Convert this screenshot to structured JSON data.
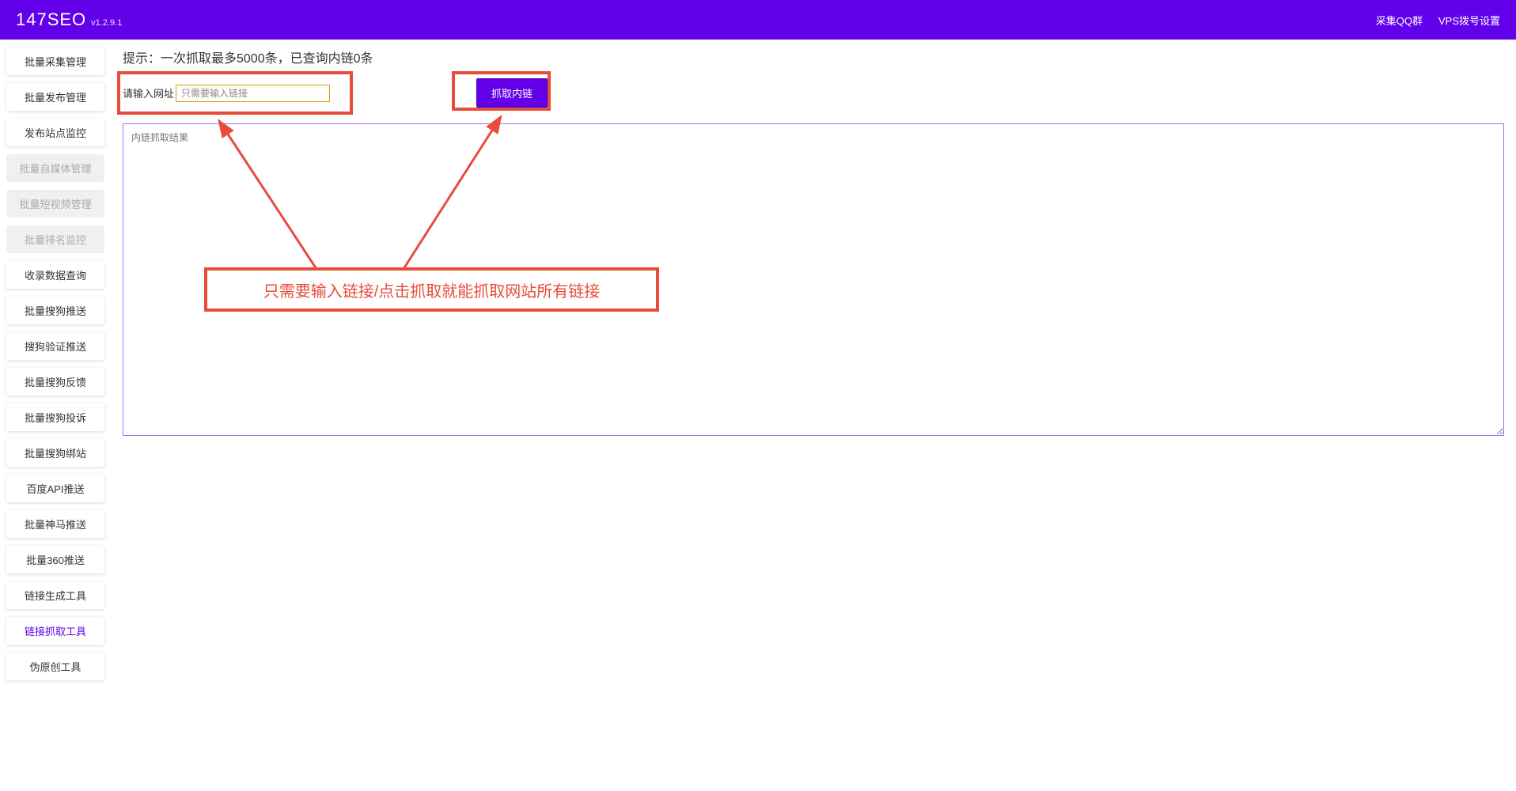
{
  "header": {
    "title": "147SEO",
    "version": "v1.2.9.1",
    "links": [
      "采集QQ群",
      "VPS拨号设置"
    ]
  },
  "sidebar": {
    "items": [
      {
        "label": "批量采集管理",
        "state": "normal"
      },
      {
        "label": "批量发布管理",
        "state": "normal"
      },
      {
        "label": "发布站点监控",
        "state": "normal"
      },
      {
        "label": "批量自媒体管理",
        "state": "disabled"
      },
      {
        "label": "批量短视频管理",
        "state": "disabled"
      },
      {
        "label": "批量排名监控",
        "state": "disabled"
      },
      {
        "label": "收录数据查询",
        "state": "normal"
      },
      {
        "label": "批量搜狗推送",
        "state": "normal"
      },
      {
        "label": "搜狗验证推送",
        "state": "normal"
      },
      {
        "label": "批量搜狗反馈",
        "state": "normal"
      },
      {
        "label": "批量搜狗投诉",
        "state": "normal"
      },
      {
        "label": "批量搜狗绑站",
        "state": "normal"
      },
      {
        "label": "百度API推送",
        "state": "normal"
      },
      {
        "label": "批量神马推送",
        "state": "normal"
      },
      {
        "label": "批量360推送",
        "state": "normal"
      },
      {
        "label": "链接生成工具",
        "state": "normal"
      },
      {
        "label": "链接抓取工具",
        "state": "active"
      },
      {
        "label": "伪原创工具",
        "state": "normal"
      }
    ]
  },
  "main": {
    "hint": "提示：一次抓取最多5000条，已查询内链0条",
    "input_label": "请输入网址",
    "input_placeholder": "只需要输入链接",
    "fetch_button": "抓取内链",
    "result_placeholder": "内链抓取结果"
  },
  "annotation": {
    "text": "只需要输入链接/点击抓取就能抓取网站所有链接"
  }
}
